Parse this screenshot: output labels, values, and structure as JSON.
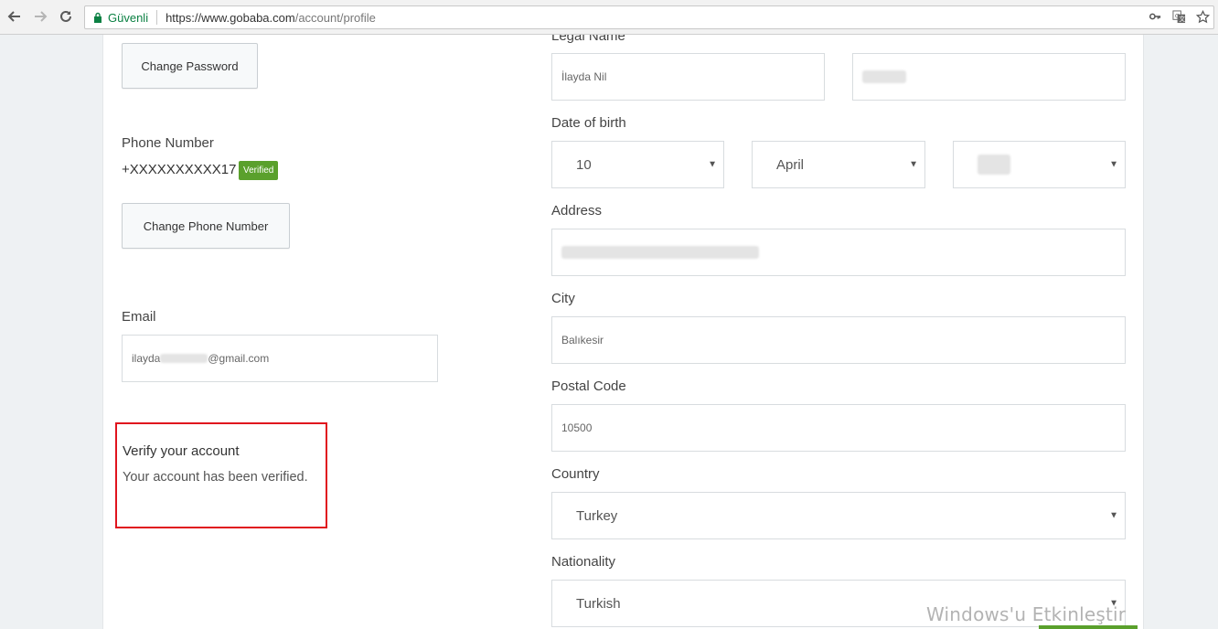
{
  "browser": {
    "secure_label": "Güvenli",
    "url_host": "https://www.gobaba.com",
    "url_path": "/account/profile",
    "icons": [
      "back-icon",
      "forward-icon",
      "reload-icon",
      "lock-icon",
      "key-icon",
      "translate-icon",
      "star-icon"
    ]
  },
  "left": {
    "change_password_label": "Change Password",
    "phone_label": "Phone Number",
    "phone_value": "+XXXXXXXXXX17",
    "verified_badge": "Verified",
    "change_phone_label": "Change Phone Number",
    "email_label": "Email",
    "email_prefix": "ilayda",
    "email_suffix": "@gmail.com",
    "verify_title": "Verify your account",
    "verify_text": "Your account has been verified."
  },
  "right": {
    "legal_name_label": "Legal Name",
    "first_name_value": "İlayda Nil",
    "dob_label": "Date of birth",
    "dob_day": "10",
    "dob_month": "April",
    "address_label": "Address",
    "city_label": "City",
    "city_value": "Balıkesir",
    "postal_label": "Postal Code",
    "postal_value": "10500",
    "country_label": "Country",
    "country_value": "Turkey",
    "nationality_label": "Nationality",
    "nationality_value": "Turkish"
  },
  "overlay": {
    "watermark": "Windows'u Etkinleştir"
  },
  "colors": {
    "accent_green": "#5aa02c",
    "highlight_red": "#e0141e",
    "secure_green": "#0b8043"
  }
}
